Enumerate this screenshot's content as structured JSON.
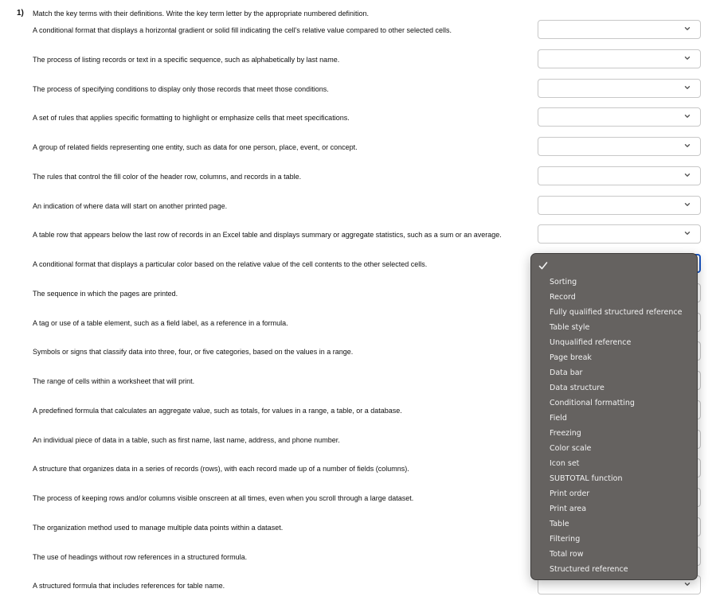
{
  "question": {
    "number": "1)",
    "instruction": "Match the key terms with their definitions. Write the key term letter by the appropriate numbered definition."
  },
  "definitions": [
    {
      "text": "A conditional format that displays a horizontal gradient or solid fill indicating the cell's relative value compared to other selected cells.",
      "selected": ""
    },
    {
      "text": "The process of listing records or text in a specific sequence, such as alphabetically by last name.",
      "selected": ""
    },
    {
      "text": "The process of specifying conditions to display only those records that meet those conditions.",
      "selected": ""
    },
    {
      "text": "A set of rules that applies specific formatting to highlight or emphasize cells that meet specifications.",
      "selected": ""
    },
    {
      "text": "A group of related fields representing one entity, such as data for one person, place, event, or concept.",
      "selected": ""
    },
    {
      "text": "The rules that control the fill color of the header row, columns, and records in a table.",
      "selected": ""
    },
    {
      "text": "An indication of where data will start on another printed page.",
      "selected": ""
    },
    {
      "text": "A table row that appears below the last row of records in an Excel table and displays summary or aggregate statistics, such as a sum or an average.",
      "selected": ""
    },
    {
      "text": "A conditional format that displays a particular color based on the relative value of the cell contents to the other selected cells.",
      "selected": "",
      "focused": true
    },
    {
      "text": "The sequence in which the pages are printed.",
      "selected": ""
    },
    {
      "text": "A tag or use of a table element, such as a field label, as a reference in a formula.",
      "selected": ""
    },
    {
      "text": "Symbols or signs that classify data into three, four, or five categories, based on the values in a range.",
      "selected": ""
    },
    {
      "text": "The range of cells within a worksheet that will print.",
      "selected": ""
    },
    {
      "text": "A predefined formula that calculates an aggregate value, such as totals, for values in a range, a table, or a database.",
      "selected": ""
    },
    {
      "text": "An individual piece of data in a table, such as first name, last name, address, and phone number.",
      "selected": ""
    },
    {
      "text": "A structure that organizes data in a series of records (rows), with each record made up of a number of fields (columns).",
      "selected": ""
    },
    {
      "text": "The process of keeping rows and/or columns visible onscreen at all times, even when you scroll through a large dataset.",
      "selected": ""
    },
    {
      "text": "The organization method used to manage multiple data points within a dataset.",
      "selected": ""
    },
    {
      "text": "The use of headings without row references in a structured formula.",
      "selected": ""
    },
    {
      "text": "A structured formula that includes references for table name.",
      "selected": ""
    }
  ],
  "dropdown": {
    "open_for_row": 9,
    "checked_option": "",
    "options": [
      "Sorting",
      "Record",
      "Fully qualified structured reference",
      "Table style",
      "Unqualified reference",
      "Page break",
      "Data bar",
      "Data structure",
      "Conditional formatting",
      "Field",
      "Freezing",
      "Color scale",
      "Icon set",
      "SUBTOTAL function",
      "Print order",
      "Print area",
      "Table",
      "Filtering",
      "Total row",
      "Structured reference"
    ]
  },
  "colors": {
    "focus_border": "#1a56c4",
    "menu_bg": "#656260",
    "menu_text": "#f2f2f2"
  }
}
